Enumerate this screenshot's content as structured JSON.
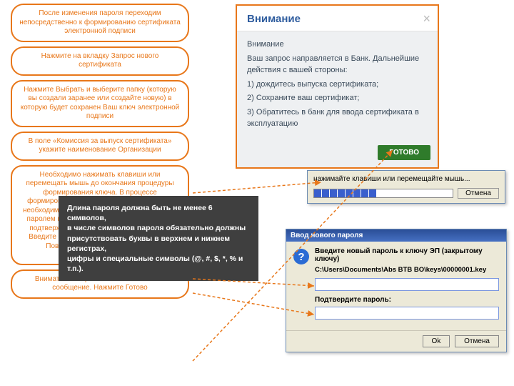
{
  "bubbles": {
    "b0": "После изменения пароля переходим непосредственно к формированию сертификата электронной подписи",
    "b1": "Нажмите на вкладку Запрос нового сертификата",
    "b2": "Нажмите Выбрать и выберите папку (которую вы создали заранее или создайте новую) в которую будет сохранен Ваш ключ электронной подписи",
    "b3": "В поле «Комиссия за выпуск сертификата» укажите наименование Организации",
    "b4": "Необходимо нажимать клавиши или перемещать мышь до окончания процедуры формирования ключа. В процессе формирования ключа электронной подписи необходимо придумать и ввести пароль. Этим паролем при дальнейшей работе вы будете подтверждать свою электронную подпись. Введите пароль для электронной подписи. Повторите пароль. Нажмите ОК.",
    "b5": "Внимательно прочитайте появившееся сообщение. Нажмите Готово"
  },
  "tooltip": {
    "l1": "Длина пароля должна быть не менее 6 символов,",
    "l2": "в числе символов пароля обязательно должны присутствовать буквы в верхнем и нижнем регистрах,",
    "l3": "цифры и специальные символы (@, #, $, *, % и т.п.)."
  },
  "attention": {
    "title": "Внимание",
    "sub": "Внимание",
    "p1": "Ваш запрос направляется в Банк. Дальнейшие действия с вашей стороны:",
    "i1": "1) дождитесь выпуска сертификата;",
    "i2": "2) Сохраните ваш сертификат;",
    "i3": "3) Обратитесь в банк для ввода сертификата в эксплуатацию",
    "ready": "Готово",
    "close": "×"
  },
  "rng": {
    "msg": "нажимайте клавиши или перемещайте мышь...",
    "cancel": "Отмена"
  },
  "pw": {
    "title": "Ввод нового пароля",
    "l1": "Введите новый пароль к ключу ЭП (закрытому ключу)",
    "path": "C:\\Users\\Documents\\Abs BTB BO\\keys\\00000001.key",
    "confirm": "Подтвердите пароль:",
    "ok": "Ok",
    "cancel": "Отмена"
  }
}
